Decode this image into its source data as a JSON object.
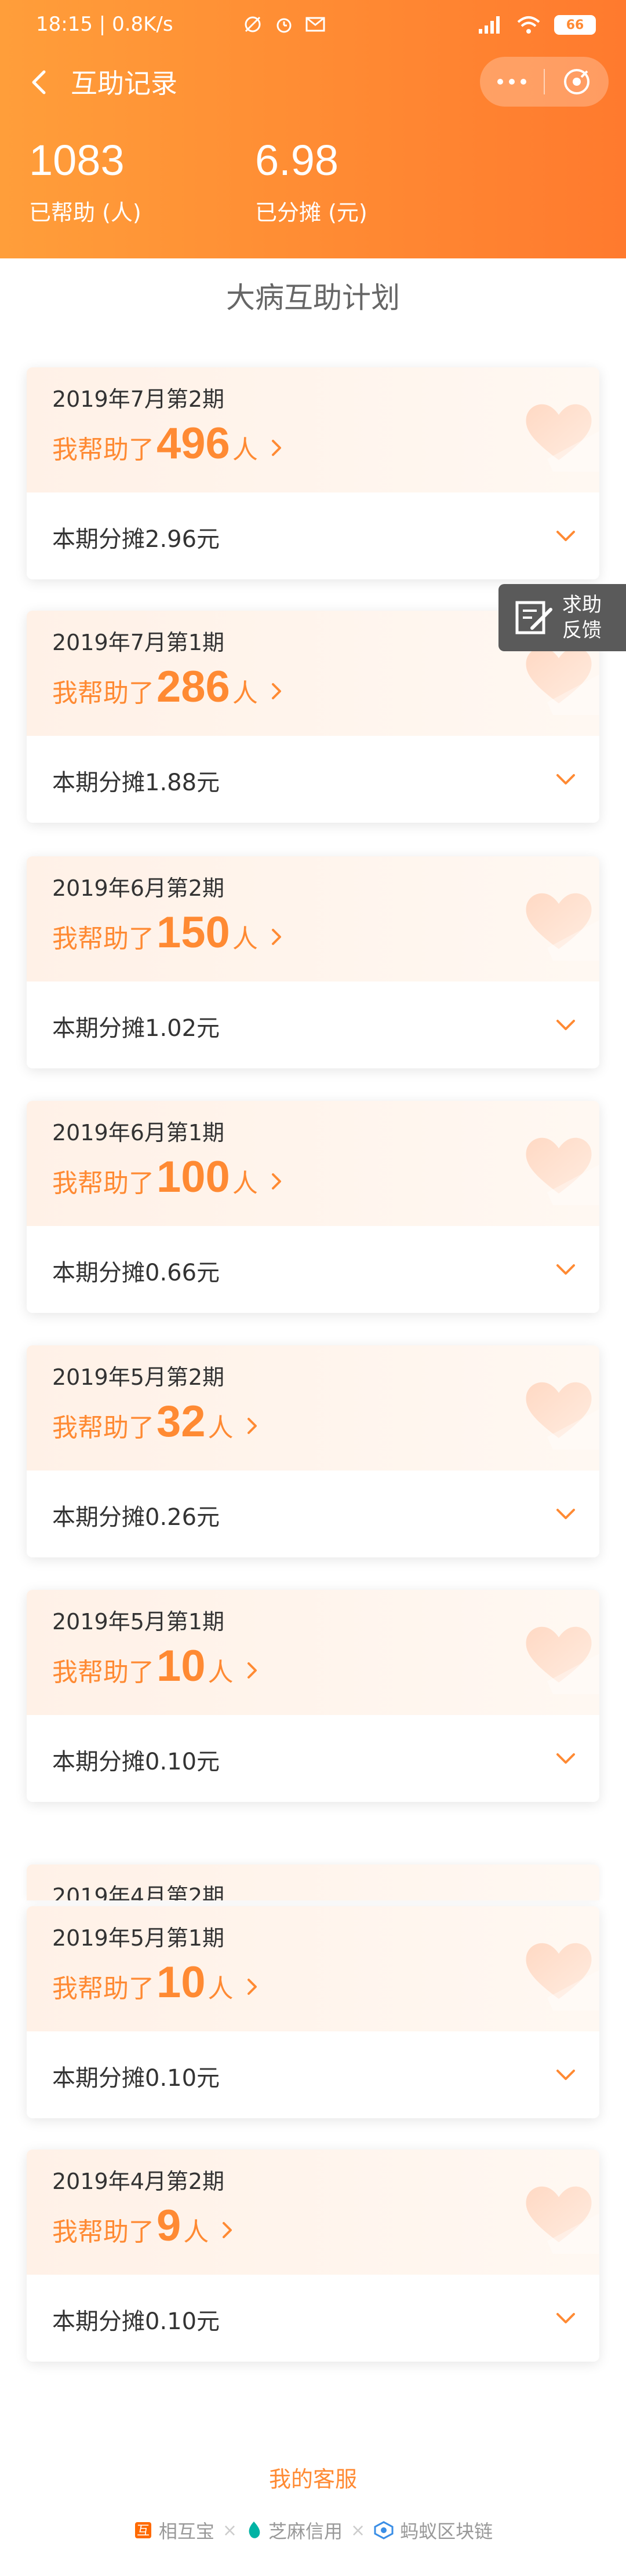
{
  "status": {
    "time": "18:15",
    "speed": "0.8K/s",
    "battery": "66"
  },
  "nav": {
    "title": "互助记录"
  },
  "stats": {
    "helped_count": "1083",
    "helped_label": "已帮助 (人)",
    "shared_amount": "6.98",
    "shared_label": "已分摊 (元)"
  },
  "plan_title": "大病互助计划",
  "cards": [
    {
      "period": "2019年7月第2期",
      "prefix": "我帮助了",
      "count": "496",
      "suffix": "人",
      "share": "本期分摊2.96元"
    },
    {
      "period": "2019年7月第1期",
      "prefix": "我帮助了",
      "count": "286",
      "suffix": "人",
      "share": "本期分摊1.88元"
    },
    {
      "period": "2019年6月第2期",
      "prefix": "我帮助了",
      "count": "150",
      "suffix": "人",
      "share": "本期分摊1.02元"
    },
    {
      "period": "2019年6月第1期",
      "prefix": "我帮助了",
      "count": "100",
      "suffix": "人",
      "share": "本期分摊0.66元"
    },
    {
      "period": "2019年5月第2期",
      "prefix": "我帮助了",
      "count": "32",
      "suffix": "人",
      "share": "本期分摊0.26元"
    },
    {
      "period": "2019年5月第1期",
      "prefix": "我帮助了",
      "count": "10",
      "suffix": "人",
      "share": "本期分摊0.10元"
    },
    {
      "period": "2019年5月第1期",
      "prefix": "我帮助了",
      "count": "10",
      "suffix": "人",
      "share": "本期分摊0.10元"
    },
    {
      "period": "2019年4月第2期",
      "prefix": "我帮助了",
      "count": "9",
      "suffix": "人",
      "share": "本期分摊0.10元"
    }
  ],
  "partial_card": {
    "period": "2019年4月第2期"
  },
  "feedback": {
    "line1": "求助",
    "line2": "反馈"
  },
  "footer": {
    "service": "我的客服",
    "brand1": "相互宝",
    "brand2": "芝麻信用",
    "brand3": "蚂蚁区块链"
  },
  "colors": {
    "accent": "#ff8a33",
    "header_start": "#ff9e3a",
    "header_end": "#ff7a2e",
    "feedback_bg": "#5a5a5a"
  },
  "icons": [
    "back-arrow-icon",
    "more-dots-icon",
    "close-target-icon",
    "heart-icon",
    "chevron-down-icon",
    "edit-feedback-icon",
    "wifi-icon",
    "signal-icon",
    "alarm-icon",
    "mail-icon"
  ]
}
